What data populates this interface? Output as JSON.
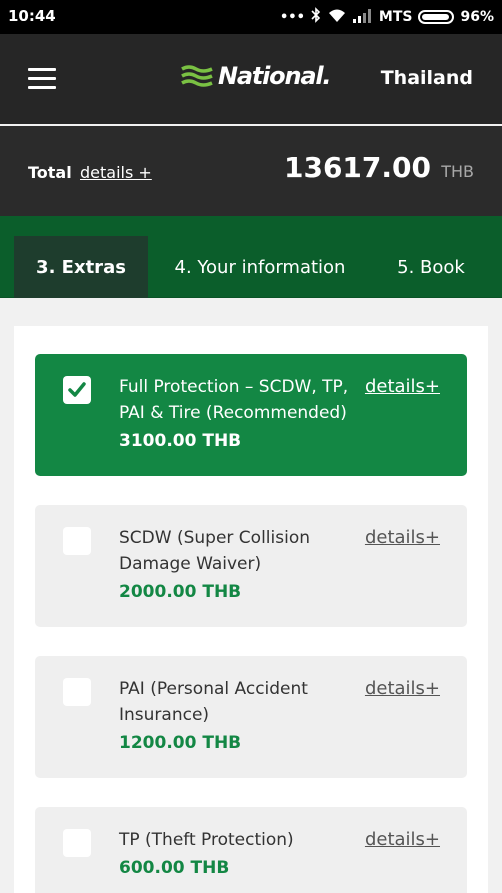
{
  "status_bar": {
    "time": "10:44",
    "carrier": "MTS",
    "battery": "96%"
  },
  "header": {
    "logo_text": "National.",
    "country": "Thailand",
    "brand_color": "#7ac143"
  },
  "total_bar": {
    "label": "Total",
    "details_link": "details +",
    "amount": "13617.00",
    "currency": "THB"
  },
  "steps": [
    {
      "label": "3. Extras",
      "active": true
    },
    {
      "label": "4. Your information",
      "active": false
    },
    {
      "label": "5. Book",
      "active": false
    }
  ],
  "extras": [
    {
      "title": "Full Protection – SCDW, TP, PAI & Tire (Recommended)",
      "price": "3100.00 THB",
      "details": "details+",
      "checked": true
    },
    {
      "title": "SCDW (Super Collision Damage Waiver)",
      "price": "2000.00 THB",
      "details": "details+",
      "checked": false
    },
    {
      "title": "PAI (Personal Accident Insurance)",
      "price": "1200.00 THB",
      "details": "details+",
      "checked": false
    },
    {
      "title": "TP (Theft Protection)",
      "price": "600.00 THB",
      "details": "details+",
      "checked": false
    }
  ],
  "colors": {
    "header_bg": "#262626",
    "steps_bg": "#0b5e2b",
    "selected_card": "#138744",
    "price_green": "#138744"
  }
}
